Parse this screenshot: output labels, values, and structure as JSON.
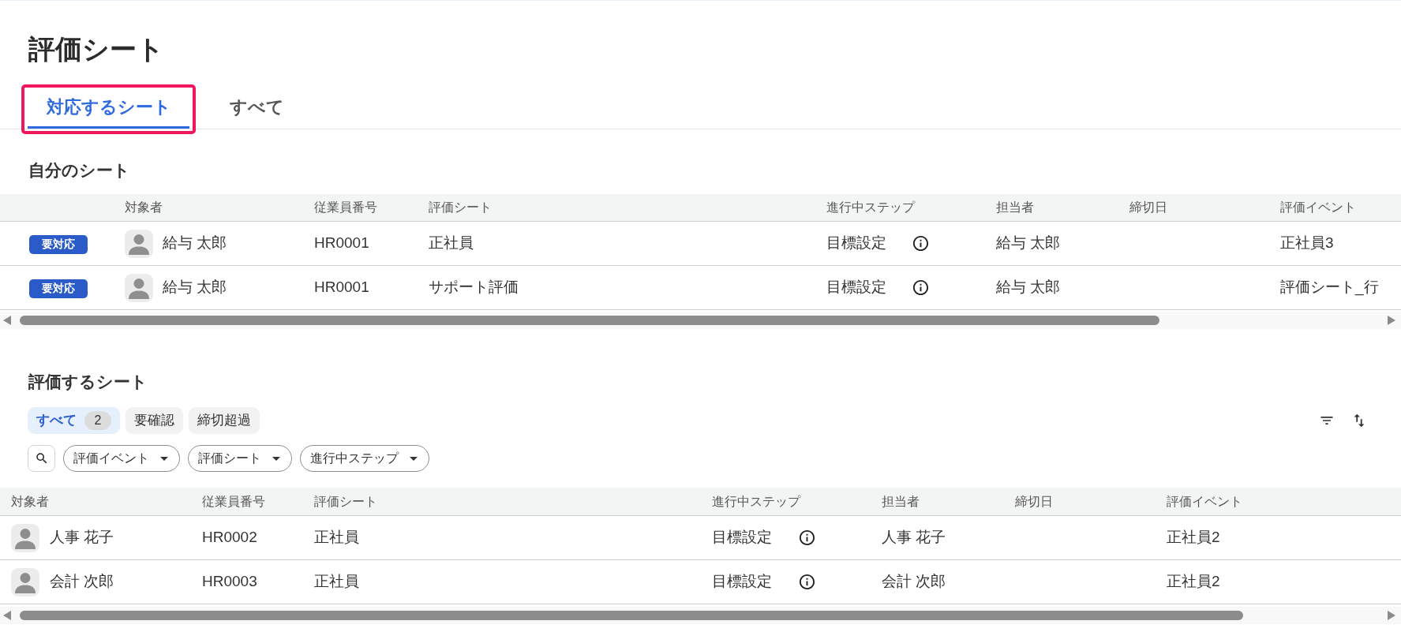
{
  "page": {
    "title": "評価シート"
  },
  "tabs": [
    {
      "label": "対応するシート",
      "selected": true,
      "highlighted": true
    },
    {
      "label": "すべて",
      "selected": false,
      "highlighted": false
    }
  ],
  "my_sheets": {
    "title": "自分のシート",
    "columns": [
      "対象者",
      "従業員番号",
      "評価シート",
      "進行中ステップ",
      "担当者",
      "締切日",
      "評価イベント"
    ],
    "rows": [
      {
        "badge": "要対応",
        "name": "給与 太郎",
        "employee_no": "HR0001",
        "sheet": "正社員",
        "step": "目標設定",
        "assignee": "給与 太郎",
        "event": "正社員3"
      },
      {
        "badge": "要対応",
        "name": "給与 太郎",
        "employee_no": "HR0001",
        "sheet": "サポート評価",
        "step": "目標設定",
        "assignee": "給与 太郎",
        "event": "評価シート_行"
      }
    ]
  },
  "review_sheets": {
    "title": "評価するシート",
    "filter_tabs": [
      {
        "label": "すべて",
        "count": "2",
        "selected": true
      },
      {
        "label": "要確認",
        "selected": false
      },
      {
        "label": "締切超過",
        "selected": false
      }
    ],
    "filters": [
      "評価イベント",
      "評価シート",
      "進行中ステップ"
    ],
    "columns": [
      "対象者",
      "従業員番号",
      "評価シート",
      "進行中ステップ",
      "担当者",
      "締切日",
      "評価イベント"
    ],
    "rows": [
      {
        "name": "人事 花子",
        "employee_no": "HR0002",
        "sheet": "正社員",
        "step": "目標設定",
        "assignee": "人事 花子",
        "event": "正社員2"
      },
      {
        "name": "会計 次郎",
        "employee_no": "HR0003",
        "sheet": "正社員",
        "step": "目標設定",
        "assignee": "会計 次郎",
        "event": "正社員2"
      }
    ]
  }
}
